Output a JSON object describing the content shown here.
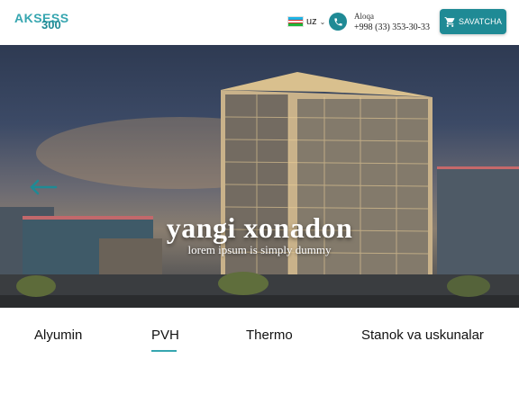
{
  "header": {
    "logo_main": "AKSESS",
    "logo_sub": "300",
    "lang_code": "uz",
    "contact_label": "Aloqa",
    "contact_phone": "+998 (33) 353-30-33",
    "cart_label": "SAVATCHA"
  },
  "hero": {
    "title": "yangi xonadon",
    "subtitle": "lorem ipsum is simply dummy"
  },
  "tabs": [
    {
      "label": "Alyumin"
    },
    {
      "label": "PVH"
    },
    {
      "label": "Thermo"
    },
    {
      "label": "Stanok va uskunalar"
    }
  ],
  "active_tab": "PVH",
  "colors": {
    "accent": "#1f8a95",
    "logo": "#36a6b0"
  }
}
